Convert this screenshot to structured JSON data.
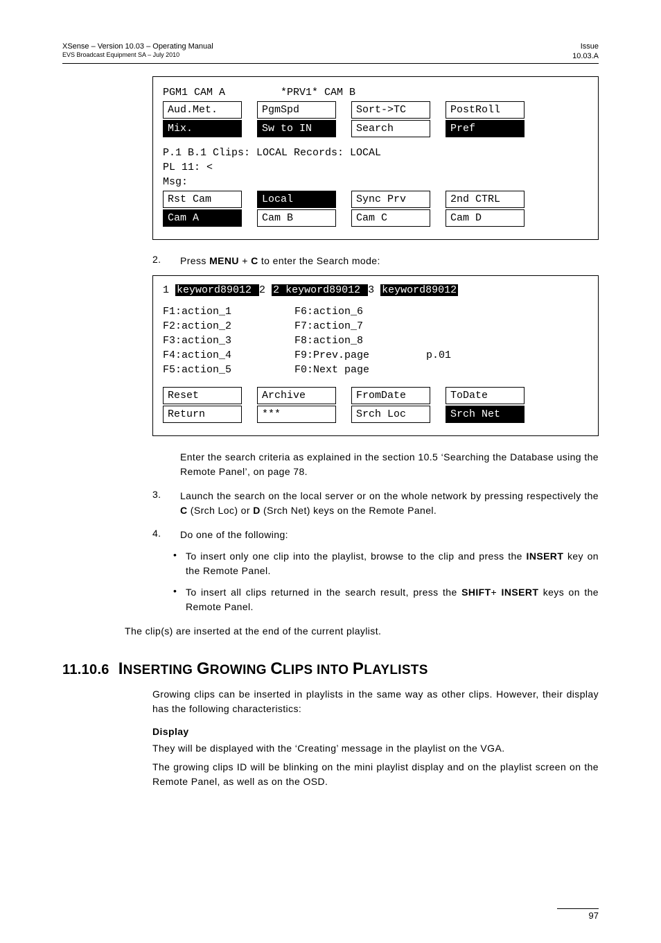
{
  "header": {
    "left_line1": "XSense – Version 10.03 – Operating Manual",
    "left_line2": "EVS Broadcast Equipment SA – July 2010",
    "right_line1": "Issue",
    "right_line2": "10.03.A"
  },
  "panel1": {
    "title_left": "PGM1 CAM A",
    "title_right": "*PRV1* CAM B",
    "row1": {
      "c1": "Aud.Met.",
      "c2": "PgmSpd",
      "c3": "Sort->TC",
      "c4": "PostRoll"
    },
    "row2": {
      "c1": "Mix.",
      "c2": "Sw to IN",
      "c3": "Search",
      "c4": "Pref"
    },
    "mid1": "P.1   B.1  Clips: LOCAL Records: LOCAL",
    "mid2": "PL 11: <",
    "mid3": "Msg:",
    "row3": {
      "c1": "Rst Cam",
      "c2": "Local",
      "c3": "Sync Prv",
      "c4": "2nd CTRL"
    },
    "row4": {
      "c1": "Cam A",
      "c2": "Cam B",
      "c3": "Cam C",
      "c4": "Cam D"
    }
  },
  "step2": {
    "num": "2.",
    "text_a": "Press ",
    "text_b": "MENU",
    "text_c": " + ",
    "text_d": "C",
    "text_e": "  to enter the Search mode:"
  },
  "panel2": {
    "kw_pre1": "1 ",
    "kw1": " keyword89012  ",
    "kw_mid": " 2 ",
    "kw2": " 2 keyword89012 ",
    "kw_mid2": " 3 ",
    "kw3": " keyword89012  ",
    "left_actions": [
      "F1:action_1",
      "F2:action_2",
      "F3:action_3",
      "F4:action_4",
      "F5:action_5"
    ],
    "mid_actions": [
      "F6:action_6",
      "F7:action_7",
      "F8:action_8",
      "F9:Prev.page",
      "F0:Next page"
    ],
    "right_col": "p.01",
    "row1": {
      "c1": "Reset",
      "c2": "Archive",
      "c3": "FromDate",
      "c4": "ToDate"
    },
    "row2": {
      "c1": "Return",
      "c2": "***",
      "c3": "Srch Loc",
      "c4": "Srch Net"
    }
  },
  "para_after_panel2": "Enter the search criteria as explained in the section 10.5 ‘Searching the Database using the Remote Panel’, on page 78.",
  "step3": {
    "num": "3.",
    "a": "Launch the search on the local server or on the whole network by pressing respectively the ",
    "b": "C",
    "c": " (Srch Loc) or ",
    "d": "D",
    "e": " (Srch Net) keys on the Remote Panel."
  },
  "step4": {
    "num": "4.",
    "text": "Do one of the following:"
  },
  "bullet1": {
    "a": "To insert only one clip into the playlist, browse to the clip and press the ",
    "b": "INSERT",
    "c": " key on the Remote Panel."
  },
  "bullet2": {
    "a": "To insert all clips returned in the search result, press the ",
    "b": "SHIFT",
    "c": "+ ",
    "d": "INSERT",
    "e": " keys on the Remote Panel."
  },
  "closing": "The clip(s) are inserted at the end of the current playlist.",
  "section": {
    "num": "11.10.6",
    "title_a": "I",
    "title_rest": "nserting Growing Clips into Playlists"
  },
  "para_growing": "Growing clips can be inserted in playlists in the same way as other clips. However, their display has the following characteristics:",
  "display_h": "Display",
  "display_p1": "They will be displayed with the ‘Creating’ message in the playlist on the VGA.",
  "display_p2": "The growing clips ID will be blinking on the mini playlist display and on the playlist screen on the Remote Panel, as well as on the OSD.",
  "page_num": "97"
}
